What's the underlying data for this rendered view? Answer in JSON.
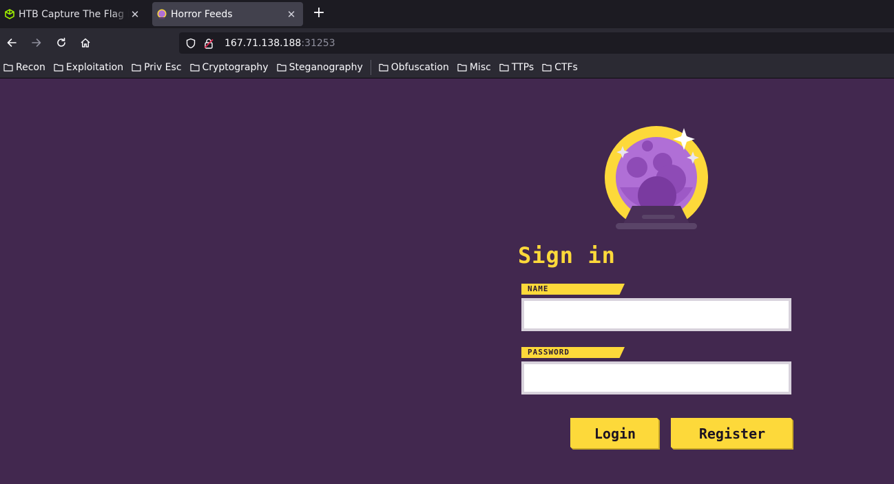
{
  "browser": {
    "tabs": [
      {
        "title": "HTB Capture The Flag Platform",
        "active": false
      },
      {
        "title": "Horror Feeds",
        "active": true
      }
    ],
    "address": {
      "host": "167.71.138.188",
      "port": ":31253"
    },
    "bookmarks": [
      "Recon",
      "Exploitation",
      "Priv Esc",
      "Cryptography",
      "Steganography",
      "Obfuscation",
      "Misc",
      "TTPs",
      "CTFs"
    ]
  },
  "login": {
    "heading": "Sign in",
    "name_label": "NAME",
    "password_label": "PASSWORD",
    "name_value": "",
    "password_value": "",
    "login_button": "Login",
    "register_button": "Register"
  },
  "colors": {
    "page_bg": "#42284f",
    "accent": "#fdd93a",
    "orb_purple": "#b06fd6"
  },
  "icons": [
    "htb-cube-icon",
    "crystal-ball-icon",
    "close-icon",
    "plus-icon",
    "back-arrow-icon",
    "forward-arrow-icon",
    "reload-icon",
    "home-icon",
    "shield-icon",
    "insecure-lock-icon",
    "folder-icon"
  ]
}
